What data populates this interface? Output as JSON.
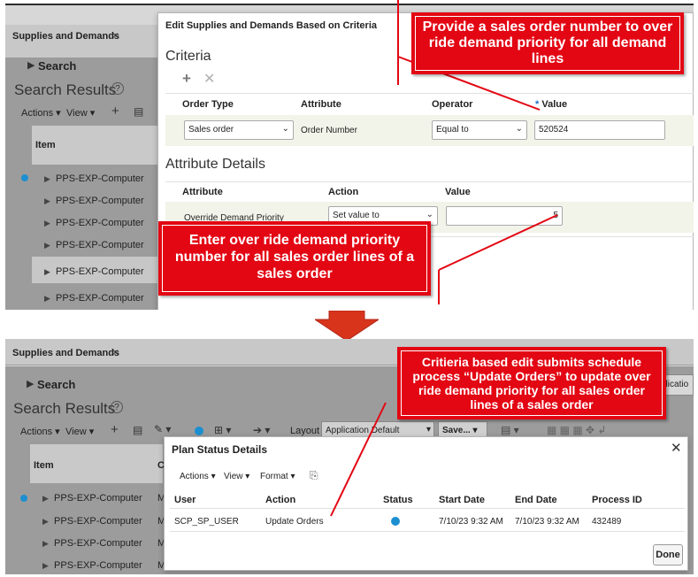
{
  "top": {
    "tab_label": "Supplies and Demands",
    "search_label": "Search",
    "results_title": "Search Results",
    "actions_label": "Actions",
    "view_label": "View",
    "item_header": "Item",
    "rows": [
      "PPS-EXP-Computer",
      "PPS-EXP-Computer",
      "PPS-EXP-Computer",
      "PPS-EXP-Computer",
      "PPS-EXP-Computer",
      "PPS-EXP-Computer"
    ],
    "dialog": {
      "title": "Edit Supplies and Demands Based on Criteria",
      "criteria_title": "Criteria",
      "col_order_type": "Order Type",
      "col_attribute": "Attribute",
      "col_operator": "Operator",
      "required_mark": "*",
      "col_value": "Value",
      "order_type_value": "Sales order",
      "attribute_value": "Order Number",
      "operator_value": "Equal to",
      "value_value": "520524",
      "attr_details_title": "Attribute Details",
      "ad_col_attribute": "Attribute",
      "ad_col_action": "Action",
      "ad_col_value": "Value",
      "ad_attribute": "Override Demand Priority",
      "ad_action": "Set value to",
      "ad_value": "5"
    },
    "callout1": "Provide a sales order number to over ride demand priority for all demand lines",
    "callout2": "Enter over ride demand priority number for all sales order lines of a sales order"
  },
  "bottom": {
    "tab_label": "Supplies and Demands",
    "search_label": "Search",
    "results_title": "Search Results",
    "actions_label": "Actions",
    "view_label": "View",
    "layout_label": "Layout",
    "layout_value": "Application Default",
    "save_label": "Save...",
    "item_header": "Item",
    "item_col2_header": "C",
    "right_clip": "olicatio",
    "rows": [
      "PPS-EXP-Computer",
      "PPS-EXP-Computer",
      "PPS-EXP-Computer",
      "PPS-EXP-Computer"
    ],
    "row_col2": [
      "M",
      "M",
      "M",
      "M"
    ],
    "dialog": {
      "title": "Plan Status Details",
      "actions_label": "Actions",
      "view_label": "View",
      "format_label": "Format",
      "col_user": "User",
      "col_action": "Action",
      "col_status": "Status",
      "col_start": "Start Date",
      "col_end": "End Date",
      "col_pid": "Process ID",
      "user": "SCP_SP_USER",
      "action": "Update Orders",
      "start": "7/10/23 9:32 AM",
      "end": "7/10/23 9:32 AM",
      "pid": "432489",
      "done_label": "Done"
    },
    "callout3": "Critieria based edit submits schedule process “Update Orders” to update over ride demand priority for all sales order lines of a sales order"
  },
  "colors": {
    "callout": "#e30613",
    "arrow": "#d8341c",
    "accent": "#1c8fd1"
  }
}
